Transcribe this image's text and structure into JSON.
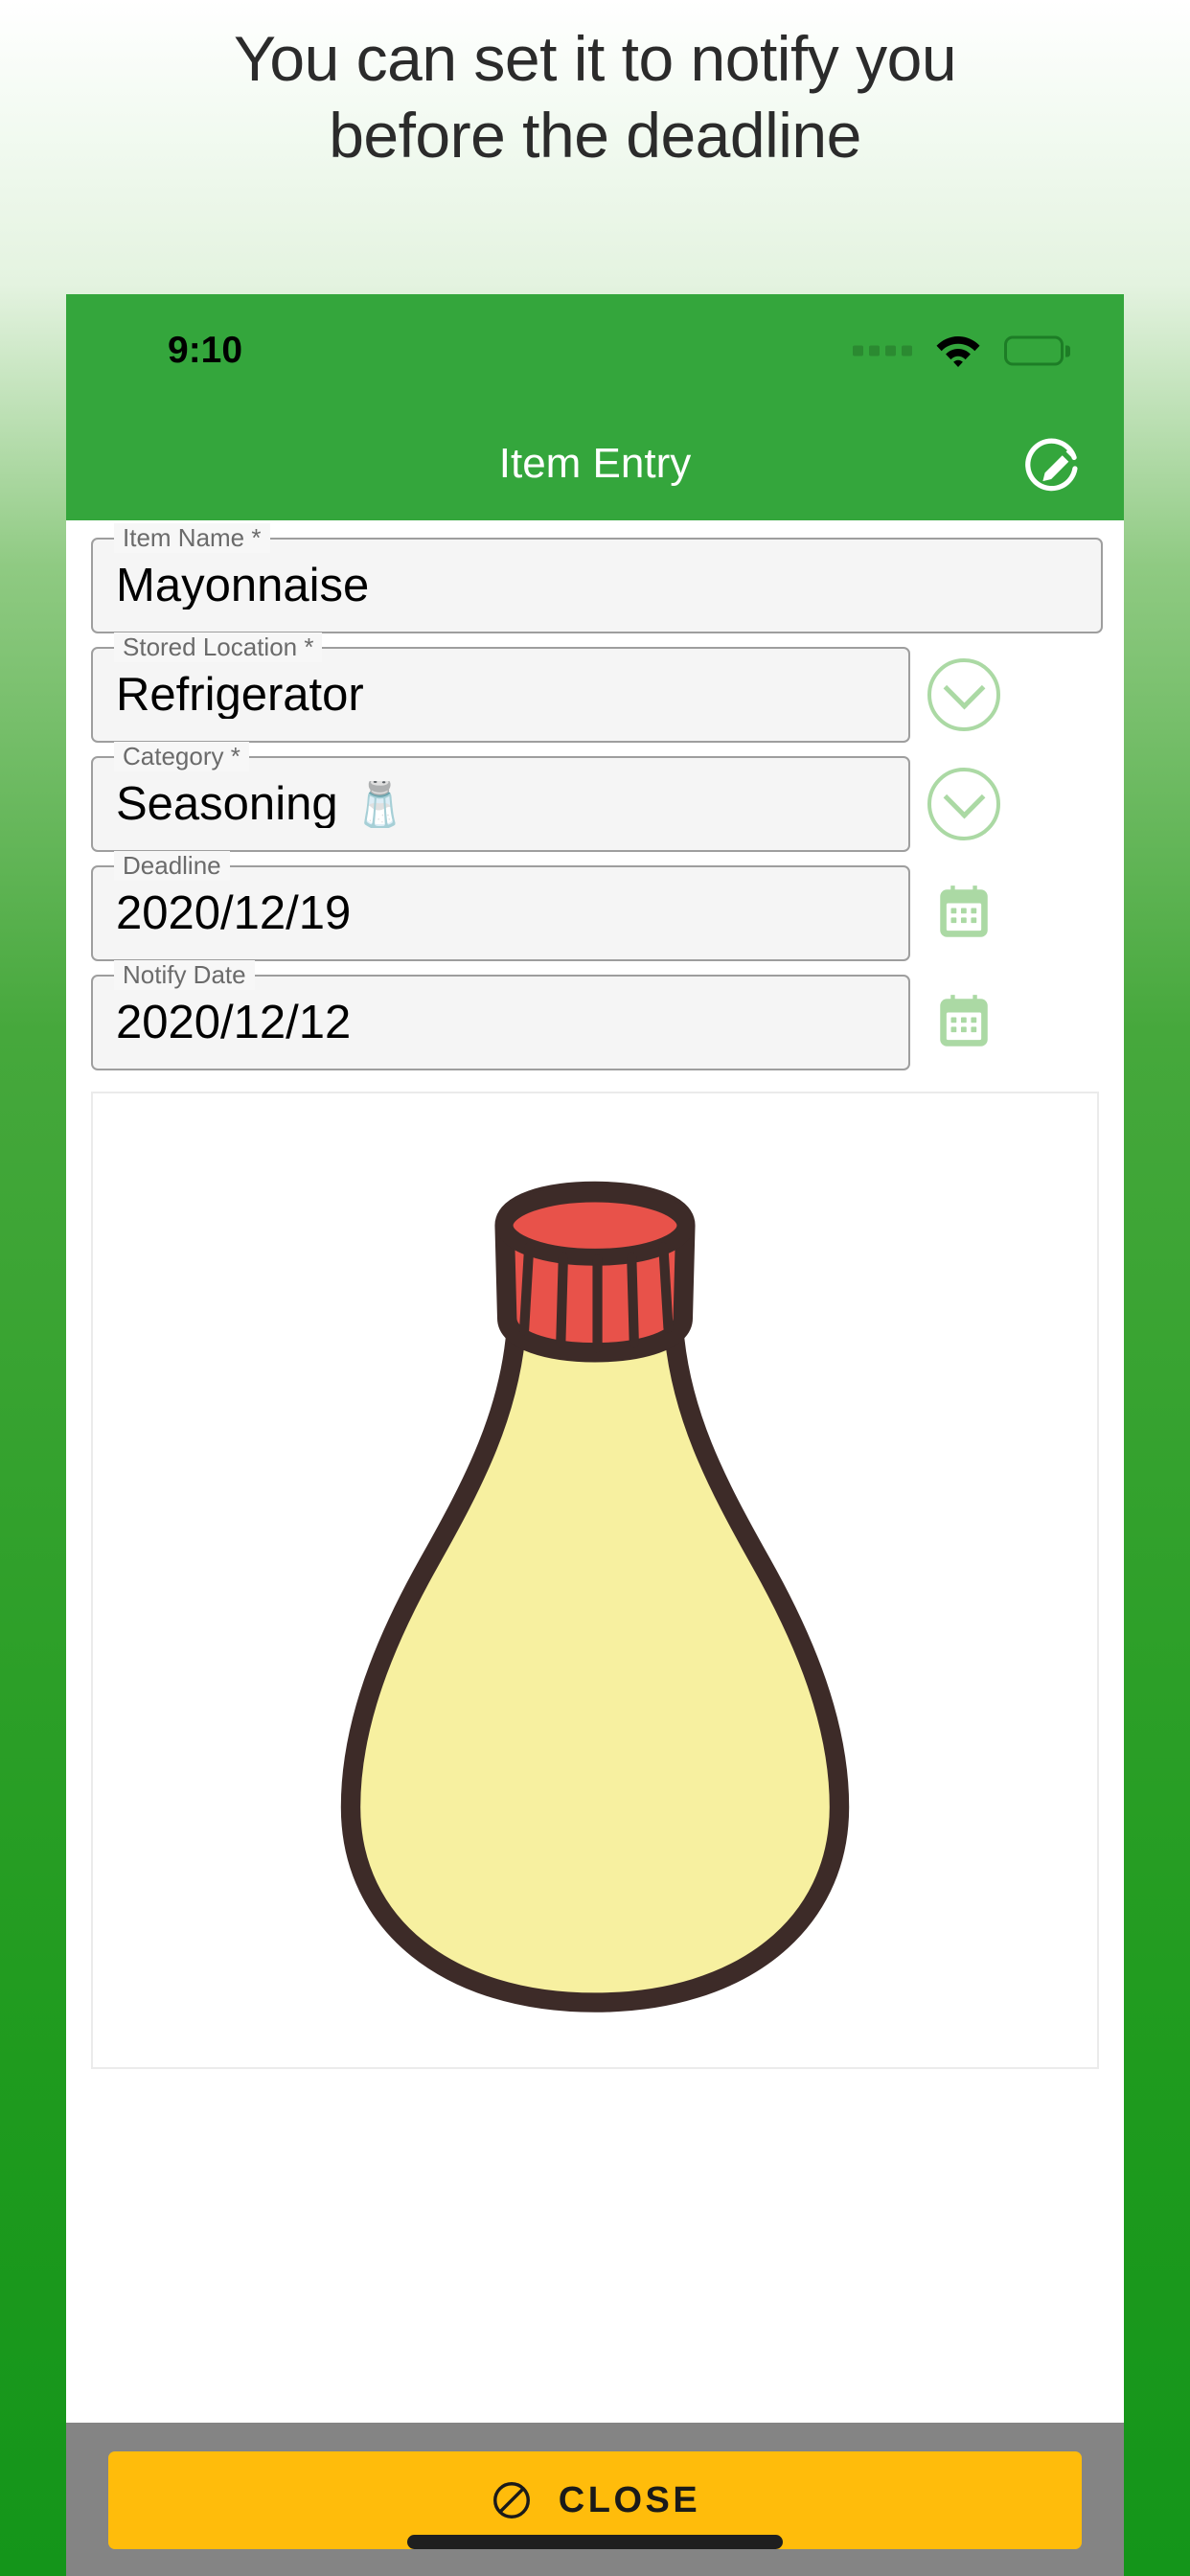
{
  "headline": {
    "line1": "You can set it to notify you",
    "line2": "before the deadline"
  },
  "status_bar": {
    "time": "9:10",
    "signal_icon": "signal-dots-icon",
    "wifi_icon": "wifi-icon",
    "battery_icon": "battery-full-icon"
  },
  "app_bar": {
    "title": "Item Entry",
    "action_icon": "edit-circle-icon"
  },
  "form": {
    "fields": [
      {
        "label": "Item Name *",
        "value": "Mayonnaise",
        "action": "none"
      },
      {
        "label": "Stored Location *",
        "value": "Refrigerator",
        "action": "dropdown",
        "action_icon": "chevron-down-circle-icon"
      },
      {
        "label": "Category *",
        "value": "Seasoning 🧂",
        "action": "dropdown",
        "action_icon": "chevron-down-circle-icon"
      },
      {
        "label": "Deadline",
        "value": "2020/12/19",
        "action": "datepicker",
        "action_icon": "calendar-icon"
      },
      {
        "label": "Notify Date",
        "value": "2020/12/12",
        "action": "datepicker",
        "action_icon": "calendar-icon"
      }
    ]
  },
  "photo": {
    "alt": "Hand-drawn mayonnaise bottle illustration",
    "colors": {
      "outline": "#3d2b28",
      "body": "#f7f0a0",
      "cap": "#e8524a"
    }
  },
  "footer": {
    "close_label": "CLOSE",
    "close_icon": "block-circle-icon"
  },
  "theme": {
    "brand_green": "#34a63c",
    "page_gradient_top": "#ffffff",
    "page_gradient_bottom": "#14951a",
    "accent_light_green": "#abd9a4",
    "close_button_yellow": "#ffbc0b",
    "footer_gray": "#848484"
  }
}
